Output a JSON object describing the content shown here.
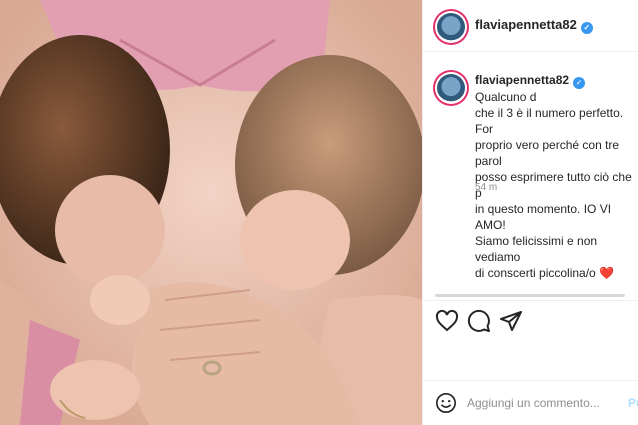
{
  "post": {
    "username": "flaviapennetta82",
    "caption_username": "flaviapennetta82",
    "caption_text": "Qualcuno d\nche il 3 è il numero perfetto. For\nproprio vero perché con tre parol\nposso esprimere tutto ciò che p\nin questo momento. IO VI AMO!\nSiamo felicissimi e non vediamo\ndi conscerti piccolina/o",
    "caption_emoji": "❤️",
    "time": "54 m"
  },
  "comment_box": {
    "placeholder": "Aggiungi un commento...",
    "post_label": "Pu"
  },
  "icons": {
    "verified": "verified-badge-icon",
    "like": "heart-icon",
    "comment": "comment-bubble-icon",
    "share": "paper-plane-icon",
    "emoji": "smiley-icon"
  },
  "colors": {
    "verified": "#3897f0",
    "story_ring": "#e1306c",
    "text": "#262626",
    "muted": "#8e8e8e"
  }
}
